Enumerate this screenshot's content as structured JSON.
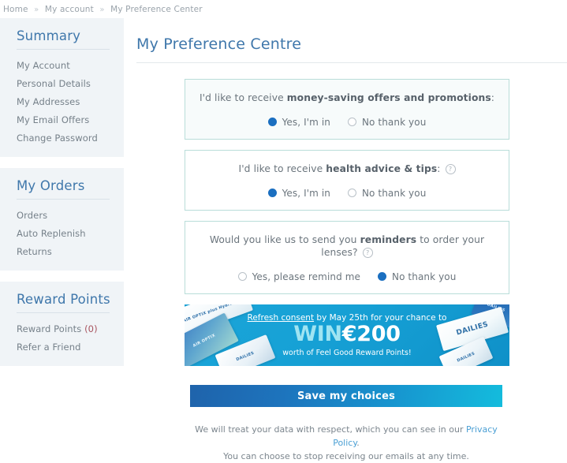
{
  "breadcrumb": {
    "items": [
      {
        "label": "Home"
      },
      {
        "label": "My account"
      },
      {
        "label": "My Preference Center"
      }
    ],
    "separator": "»"
  },
  "sidebar": {
    "cards": [
      {
        "title": "Summary",
        "items": [
          {
            "label": "My Account"
          },
          {
            "label": "Personal Details"
          },
          {
            "label": "My Addresses"
          },
          {
            "label": "My Email Offers"
          },
          {
            "label": "Change Password"
          }
        ]
      },
      {
        "title": "My Orders",
        "items": [
          {
            "label": "Orders"
          },
          {
            "label": "Auto Replenish"
          },
          {
            "label": "Returns"
          }
        ]
      },
      {
        "title": "Reward Points",
        "items": [
          {
            "label": "Reward Points",
            "count": "(0)"
          },
          {
            "label": "Refer a Friend"
          }
        ]
      }
    ]
  },
  "main": {
    "page_title": "My Preference Centre",
    "preferences": [
      {
        "question_prefix": "I'd like to receive ",
        "question_bold": "money-saving offers and promotions",
        "question_suffix": ":",
        "has_help_icon": false,
        "options": [
          {
            "label": "Yes, I'm in",
            "selected": true
          },
          {
            "label": "No thank you",
            "selected": false
          }
        ]
      },
      {
        "question_prefix": "I'd like to receive ",
        "question_bold": "health advice & tips",
        "question_suffix": ":",
        "has_help_icon": true,
        "options": [
          {
            "label": "Yes, I'm in",
            "selected": true
          },
          {
            "label": "No thank you",
            "selected": false
          }
        ]
      },
      {
        "question_prefix": "Would you like us to send you ",
        "question_bold": "reminders",
        "question_suffix": " to order your lenses?",
        "has_help_icon": true,
        "options": [
          {
            "label": "Yes, please remind me",
            "selected": false
          },
          {
            "label": "No thank you",
            "selected": true
          }
        ]
      }
    ],
    "banner": {
      "line1_link": "Refresh consent",
      "line1_rest": " by May 25th for your chance to",
      "win_word": "WIN",
      "amount": "€200",
      "line3": "worth of Feel Good Reward Points!",
      "product_labels": {
        "p1": "AIR OPTIX plus HydraGlyde",
        "p2": "AIR OPTIX",
        "p3": "DAILIES",
        "p4": "DAILIES",
        "p5": "DAILIES",
        "p6": "DAILIES"
      }
    },
    "save_button_label": "Save my choices",
    "footnote": {
      "line1_before": "We will treat your data with respect, which you can see in our ",
      "line1_link": "Privacy Policy",
      "line1_after": ".",
      "line2": "You can choose to stop receiving our emails at any time."
    }
  },
  "colors": {
    "accent_blue": "#3f77ab",
    "radio_selected": "#1b6fc0",
    "box_border": "#b9ddd9",
    "banner_bg": "#17a2d6",
    "win_text": "#9fe4f2",
    "link": "#4a9fd4",
    "count_red": "#a8545f"
  },
  "help_icon_glyph": "?"
}
